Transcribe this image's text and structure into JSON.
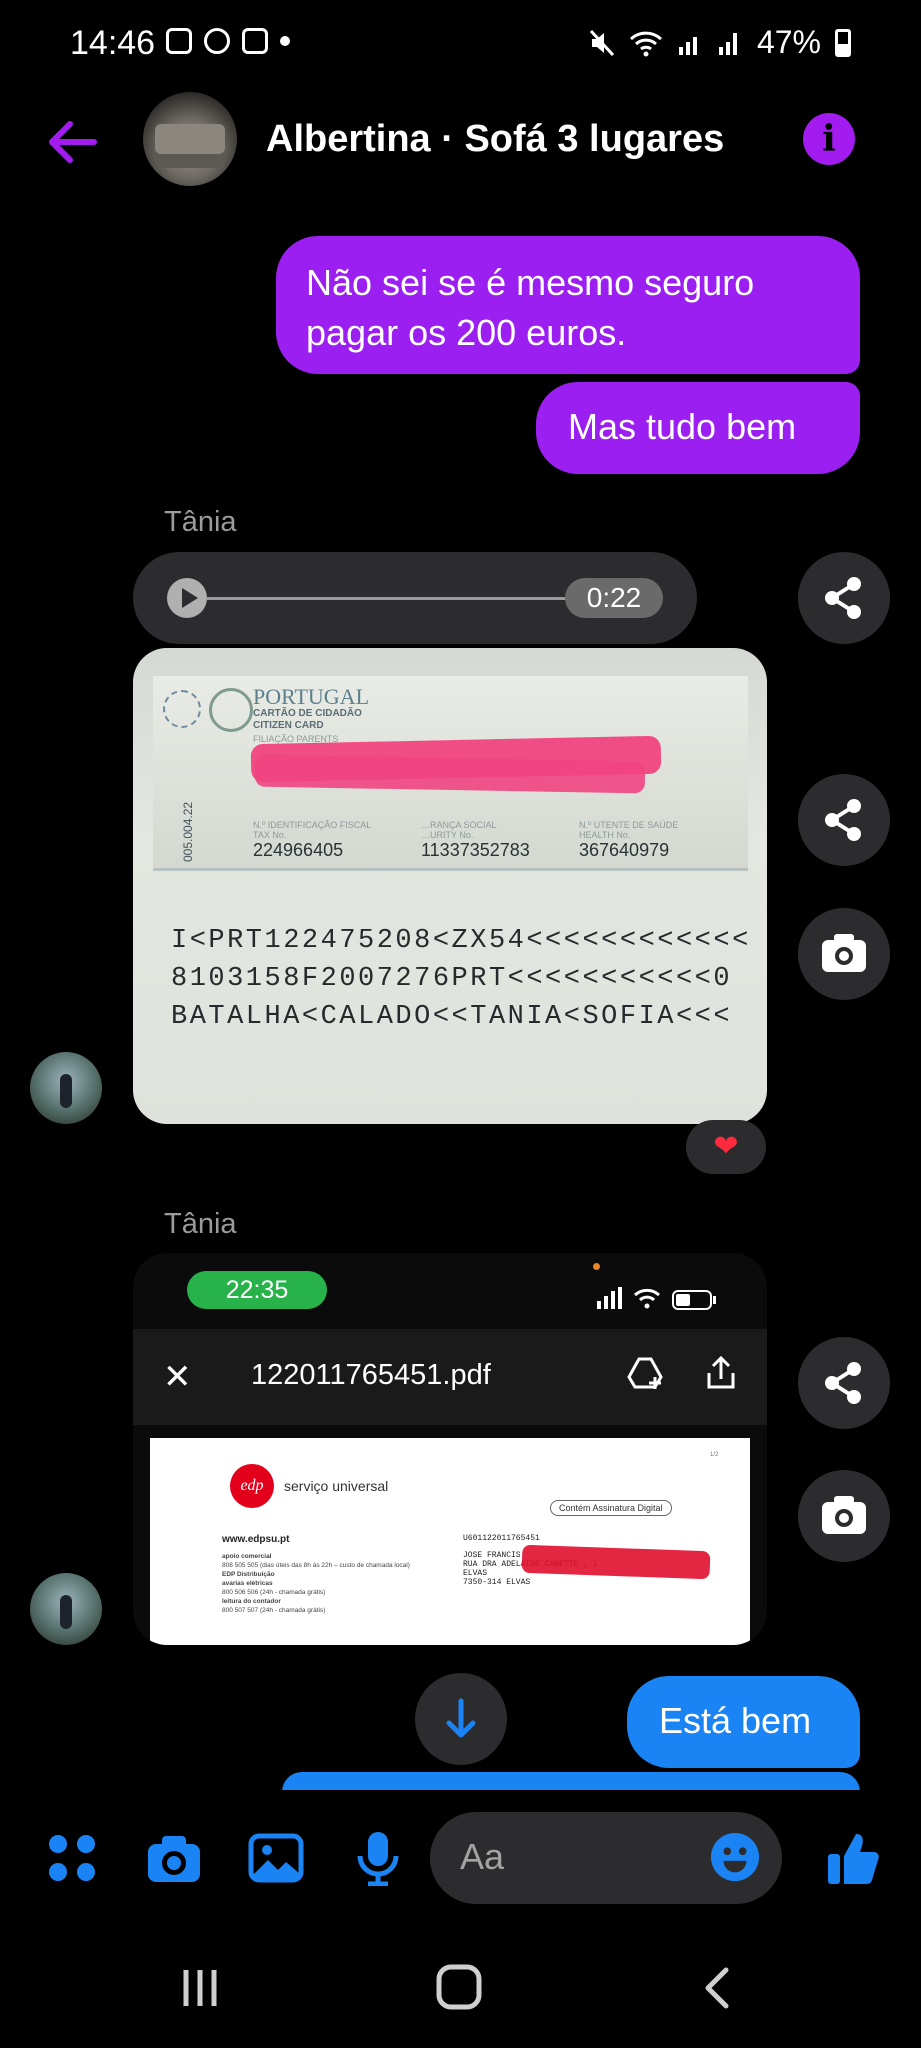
{
  "status_bar": {
    "time": "14:46",
    "battery": "47%"
  },
  "header": {
    "title": "Albertina · Sofá 3 lugares",
    "back_icon": "arrow-left-icon",
    "info_icon": "info-icon"
  },
  "colors": {
    "outgoing_purple": "#9b1ff0",
    "outgoing_blue": "#1a84f5",
    "incoming_gray": "#2c2c2e",
    "accent_blue": "#1a84f5"
  },
  "messages": {
    "out_1": "Não sei se é mesmo seguro pagar os  200 euros.",
    "out_2": "Mas tudo bem",
    "sender_1": "Tânia",
    "audio_duration": "0:22",
    "sender_2": "Tânia",
    "out_3": "Está bem"
  },
  "id_card": {
    "country": "PORTUGAL",
    "card_type": "CARTÃO DE CIDADÃO",
    "card_type_en": "CITIZEN CARD",
    "filiation_label": "FILIAÇÃO PARENTS",
    "tax_label": "N.º IDENTIFICAÇÃO FISCAL",
    "tax_label_en": "TAX No.",
    "tax_no": "224966405",
    "social_label": "…RANÇA SOCIAL",
    "social_label_en": "…URITY No.",
    "social_no": "11337352783",
    "health_label": "N.º UTENTE DE SAÚDE",
    "health_label_en": "HEALTH No.",
    "health_no": "367640979",
    "side_code": "005.004.22",
    "mrz_1": "I<PRT122475208<ZX54<<<<<<<<<<<<",
    "mrz_2": "8103158F2007276PRT<<<<<<<<<<<0",
    "mrz_3": "BATALHA<CALADO<<TANIA<SOFIA<<<"
  },
  "reaction": "❤",
  "pdf_screenshot": {
    "phone_time": "22:35",
    "filename": "122011765451.pdf",
    "brand": "edp",
    "brand_name": "serviço universal",
    "website": "www.edpsu.pt",
    "lines": [
      "apoio comercial",
      "808 505 505 (dias úteis das 8h às 22h – custo de chamada local)",
      "EDP Distribuição",
      "avarias elétricas",
      "800 506 506 (24h - chamada grátis)",
      "leitura do contador",
      "800 507 507 (24h - chamada grátis)"
    ],
    "signature_badge": "Contém Assinatura Digital",
    "account": "U601122011765451",
    "address": "JOSE FRANCIS\nRUA DRA ADELAIDE CABETTE , 1\nELVAS\n7350-314 ELVAS",
    "page_num": "1/2"
  },
  "composer": {
    "placeholder": "Aa"
  }
}
